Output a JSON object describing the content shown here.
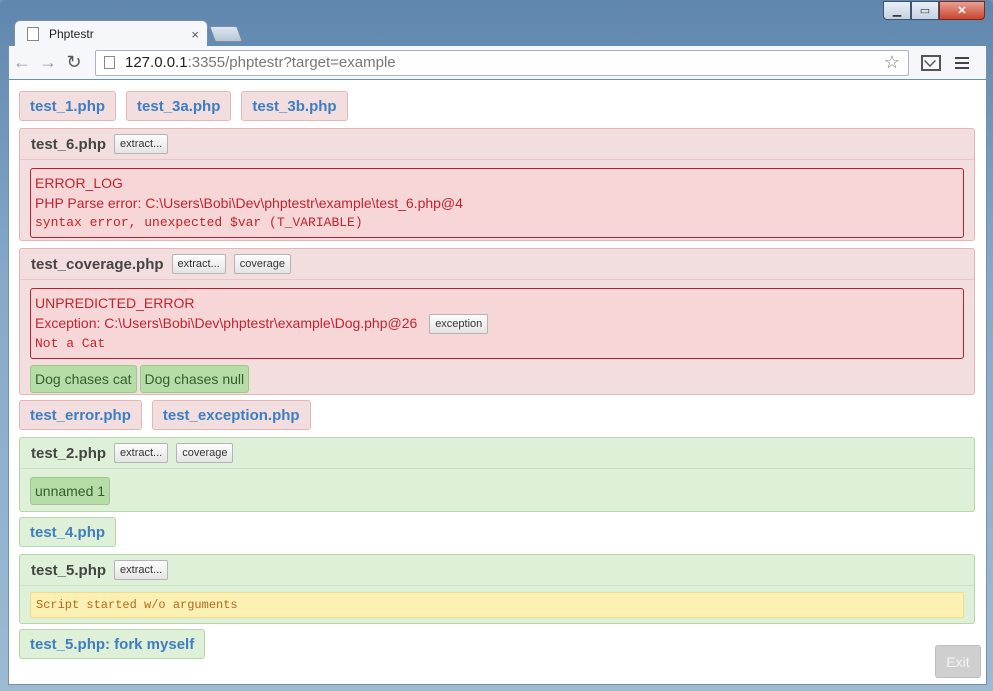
{
  "window": {
    "minimize": "▁",
    "maximize": "▭",
    "close": "✕"
  },
  "tab": {
    "title": "Phptestr",
    "close": "×"
  },
  "toolbar": {
    "back": "←",
    "forward": "→",
    "reload": "↻",
    "url_host": "127.0.0.1",
    "url_path": ":3355/phptestr?target=example",
    "star": "☆"
  },
  "rows": {
    "top": [
      "test_1.php",
      "test_3a.php",
      "test_3b.php"
    ],
    "middle": [
      "test_error.php",
      "test_exception.php"
    ],
    "test4": "test_4.php",
    "fork": "test_5.php: fork myself"
  },
  "panels": {
    "test6": {
      "title": "test_6.php",
      "buttons": [
        "extract..."
      ],
      "error": {
        "type": "ERROR_LOG",
        "message": "PHP Parse error: C:\\Users\\Bobi\\Dev\\phptestr\\example\\test_6.php@4",
        "detail": "syntax error, unexpected $var (T_VARIABLE)"
      }
    },
    "coverage": {
      "title": "test_coverage.php",
      "buttons": [
        "extract...",
        "coverage"
      ],
      "error": {
        "type": "UNPREDICTED_ERROR",
        "message": "Exception: C:\\Users\\Bobi\\Dev\\phptestr\\example\\Dog.php@26",
        "button": "exception",
        "detail": "Not a Cat"
      },
      "outcomes": [
        "Dog chases cat",
        "Dog chases null"
      ]
    },
    "test2": {
      "title": "test_2.php",
      "buttons": [
        "extract...",
        "coverage"
      ],
      "outcomes": [
        "unnamed 1"
      ]
    },
    "test5": {
      "title": "test_5.php",
      "buttons": [
        "extract..."
      ],
      "message": "Script started w/o arguments"
    }
  },
  "exit_label": "Exit",
  "colors": {
    "fail_bg": "#f2dede",
    "ok_bg": "#dff0d8",
    "link": "#3d7ec2",
    "error_text": "#c0252f",
    "warning_bg": "#fcf0b3"
  }
}
